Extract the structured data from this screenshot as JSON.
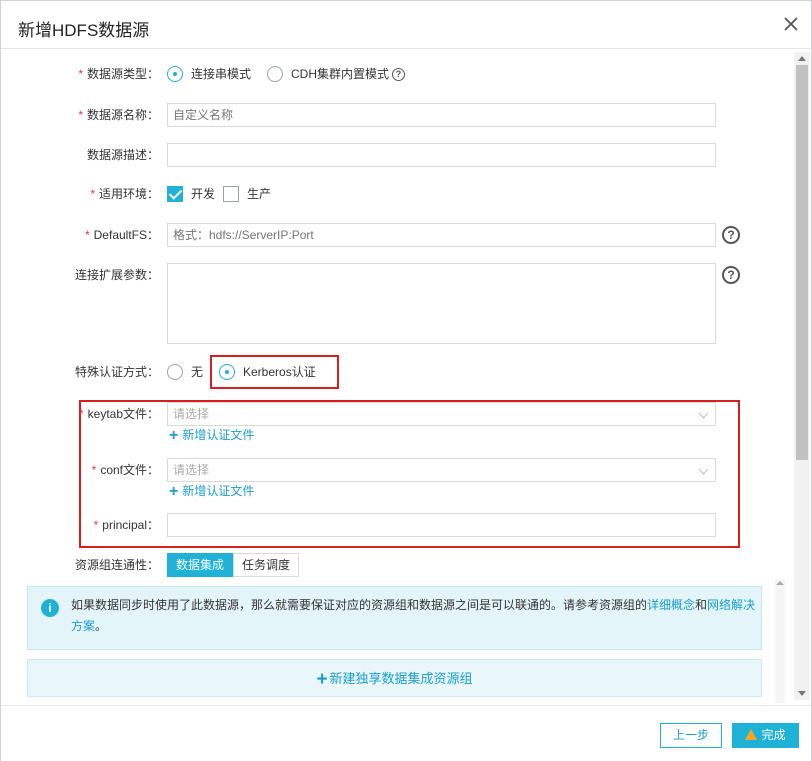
{
  "dialog": {
    "title": "新增HDFS数据源"
  },
  "form": {
    "type": {
      "label": "数据源类型：",
      "options": [
        "连接串模式",
        "CDH集群内置模式"
      ],
      "selected": 0
    },
    "name": {
      "label": "数据源名称：",
      "placeholder": "自定义名称",
      "value": ""
    },
    "desc": {
      "label": "数据源描述：",
      "value": ""
    },
    "env": {
      "label": "适用环境：",
      "options": [
        {
          "label": "开发",
          "checked": true
        },
        {
          "label": "生产",
          "checked": false
        }
      ]
    },
    "defaultfs": {
      "label": "DefaultFS：",
      "placeholder": "格式：hdfs://ServerIP:Port",
      "value": ""
    },
    "ext": {
      "label": "连接扩展参数：",
      "value": ""
    },
    "auth": {
      "label": "特殊认证方式：",
      "options": [
        "无",
        "Kerberos认证"
      ],
      "selected": 1
    },
    "keytab": {
      "label": "keytab文件：",
      "placeholder": "请选择",
      "add_label": "新增认证文件"
    },
    "conf": {
      "label": "conf文件：",
      "placeholder": "请选择",
      "add_label": "新增认证文件"
    },
    "principal": {
      "label": "principal：",
      "value": ""
    },
    "resgroup": {
      "label": "资源组连通性：",
      "tabs": [
        "数据集成",
        "任务调度"
      ],
      "selected": 0
    }
  },
  "info": {
    "text": "如果数据同步时使用了此数据源，那么就需要保证对应的资源组和数据源之间是可以联通的。请参考资源组的",
    "link1": "详细概念",
    "and": "和",
    "link2": "网络解决方案",
    "end": "。"
  },
  "new_resource_button": "新建独享数据集成资源组",
  "footer": {
    "prev": "上一步",
    "done": "完成"
  },
  "colors": {
    "accent": "#1fb2d6",
    "highlight_border": "#d81e1e",
    "required": "#e0383e"
  },
  "icons": {
    "close": "close-icon",
    "help": "question-circle-icon",
    "info": "info-icon",
    "add": "plus-icon",
    "warn": "warning-icon"
  }
}
